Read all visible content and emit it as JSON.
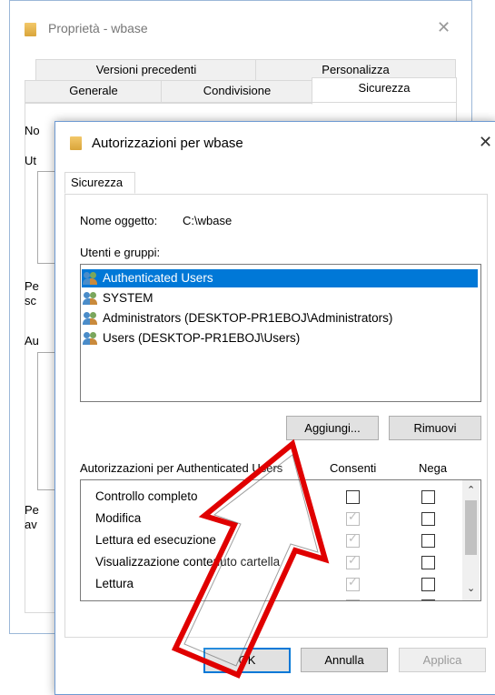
{
  "back_window": {
    "title": "Proprietà - wbase",
    "tabs_row1": [
      "Versioni precedenti",
      "Personalizza"
    ],
    "tabs_row2": [
      "Generale",
      "Condivisione",
      "Sicurezza"
    ],
    "partial_labels": [
      "No",
      "Ut",
      "Pe",
      "sc",
      "Au",
      "Pe",
      "av"
    ]
  },
  "dialog": {
    "title": "Autorizzazioni per wbase",
    "tab": "Sicurezza",
    "object_label": "Nome oggetto:",
    "object_value": "C:\\wbase",
    "users_label": "Utenti e gruppi:",
    "users": [
      {
        "name": "Authenticated Users",
        "selected": true
      },
      {
        "name": "SYSTEM",
        "selected": false
      },
      {
        "name": "Administrators (DESKTOP-PR1EBOJ\\Administrators)",
        "selected": false
      },
      {
        "name": "Users (DESKTOP-PR1EBOJ\\Users)",
        "selected": false
      }
    ],
    "add_button": "Aggiungi...",
    "remove_button": "Rimuovi",
    "permissions_header": "Autorizzazioni per Authenticated Users",
    "allow_header": "Consenti",
    "deny_header": "Nega",
    "permissions": [
      {
        "name": "Controllo completo",
        "allow": false,
        "allow_inherited": false,
        "deny": false
      },
      {
        "name": "Modifica",
        "allow": true,
        "allow_inherited": true,
        "deny": false
      },
      {
        "name": "Lettura ed esecuzione",
        "allow": true,
        "allow_inherited": true,
        "deny": false
      },
      {
        "name": "Visualizzazione contenuto cartella",
        "allow": true,
        "allow_inherited": true,
        "deny": false
      },
      {
        "name": "Lettura",
        "allow": true,
        "allow_inherited": true,
        "deny": false
      }
    ],
    "ok_button": "OK",
    "cancel_button": "Annulla",
    "apply_button": "Applica"
  },
  "annotation": {
    "color": "#e00000",
    "type": "arrow-outline"
  },
  "colors": {
    "selection": "#0078d7",
    "accent": "#0078d7"
  }
}
